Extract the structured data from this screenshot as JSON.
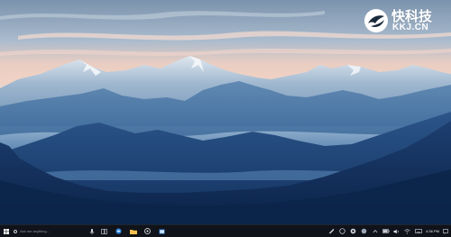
{
  "watermark": {
    "title": "快科技",
    "domain": "KKJ.CN"
  },
  "taskbar": {
    "search_placeholder": "Ask me anything...",
    "clock_time": "4:36 PM",
    "apps": [
      "task-view",
      "edge-browser",
      "file-explorer",
      "media-player",
      "store"
    ],
    "tray": [
      "network",
      "edge",
      "app-1",
      "app-2",
      "chevron-up",
      "battery",
      "volume",
      "wifi",
      "keyboard"
    ]
  },
  "colors": {
    "sky_top": "#7f97b0",
    "sky_glow": "#f0c6b6",
    "mountains_far": "#b9c9d9",
    "mountains_mid": "#3e6f9e",
    "mountains_near": "#183a6a",
    "taskbar_bg": "#101319",
    "accent": "#4aa3ff"
  }
}
